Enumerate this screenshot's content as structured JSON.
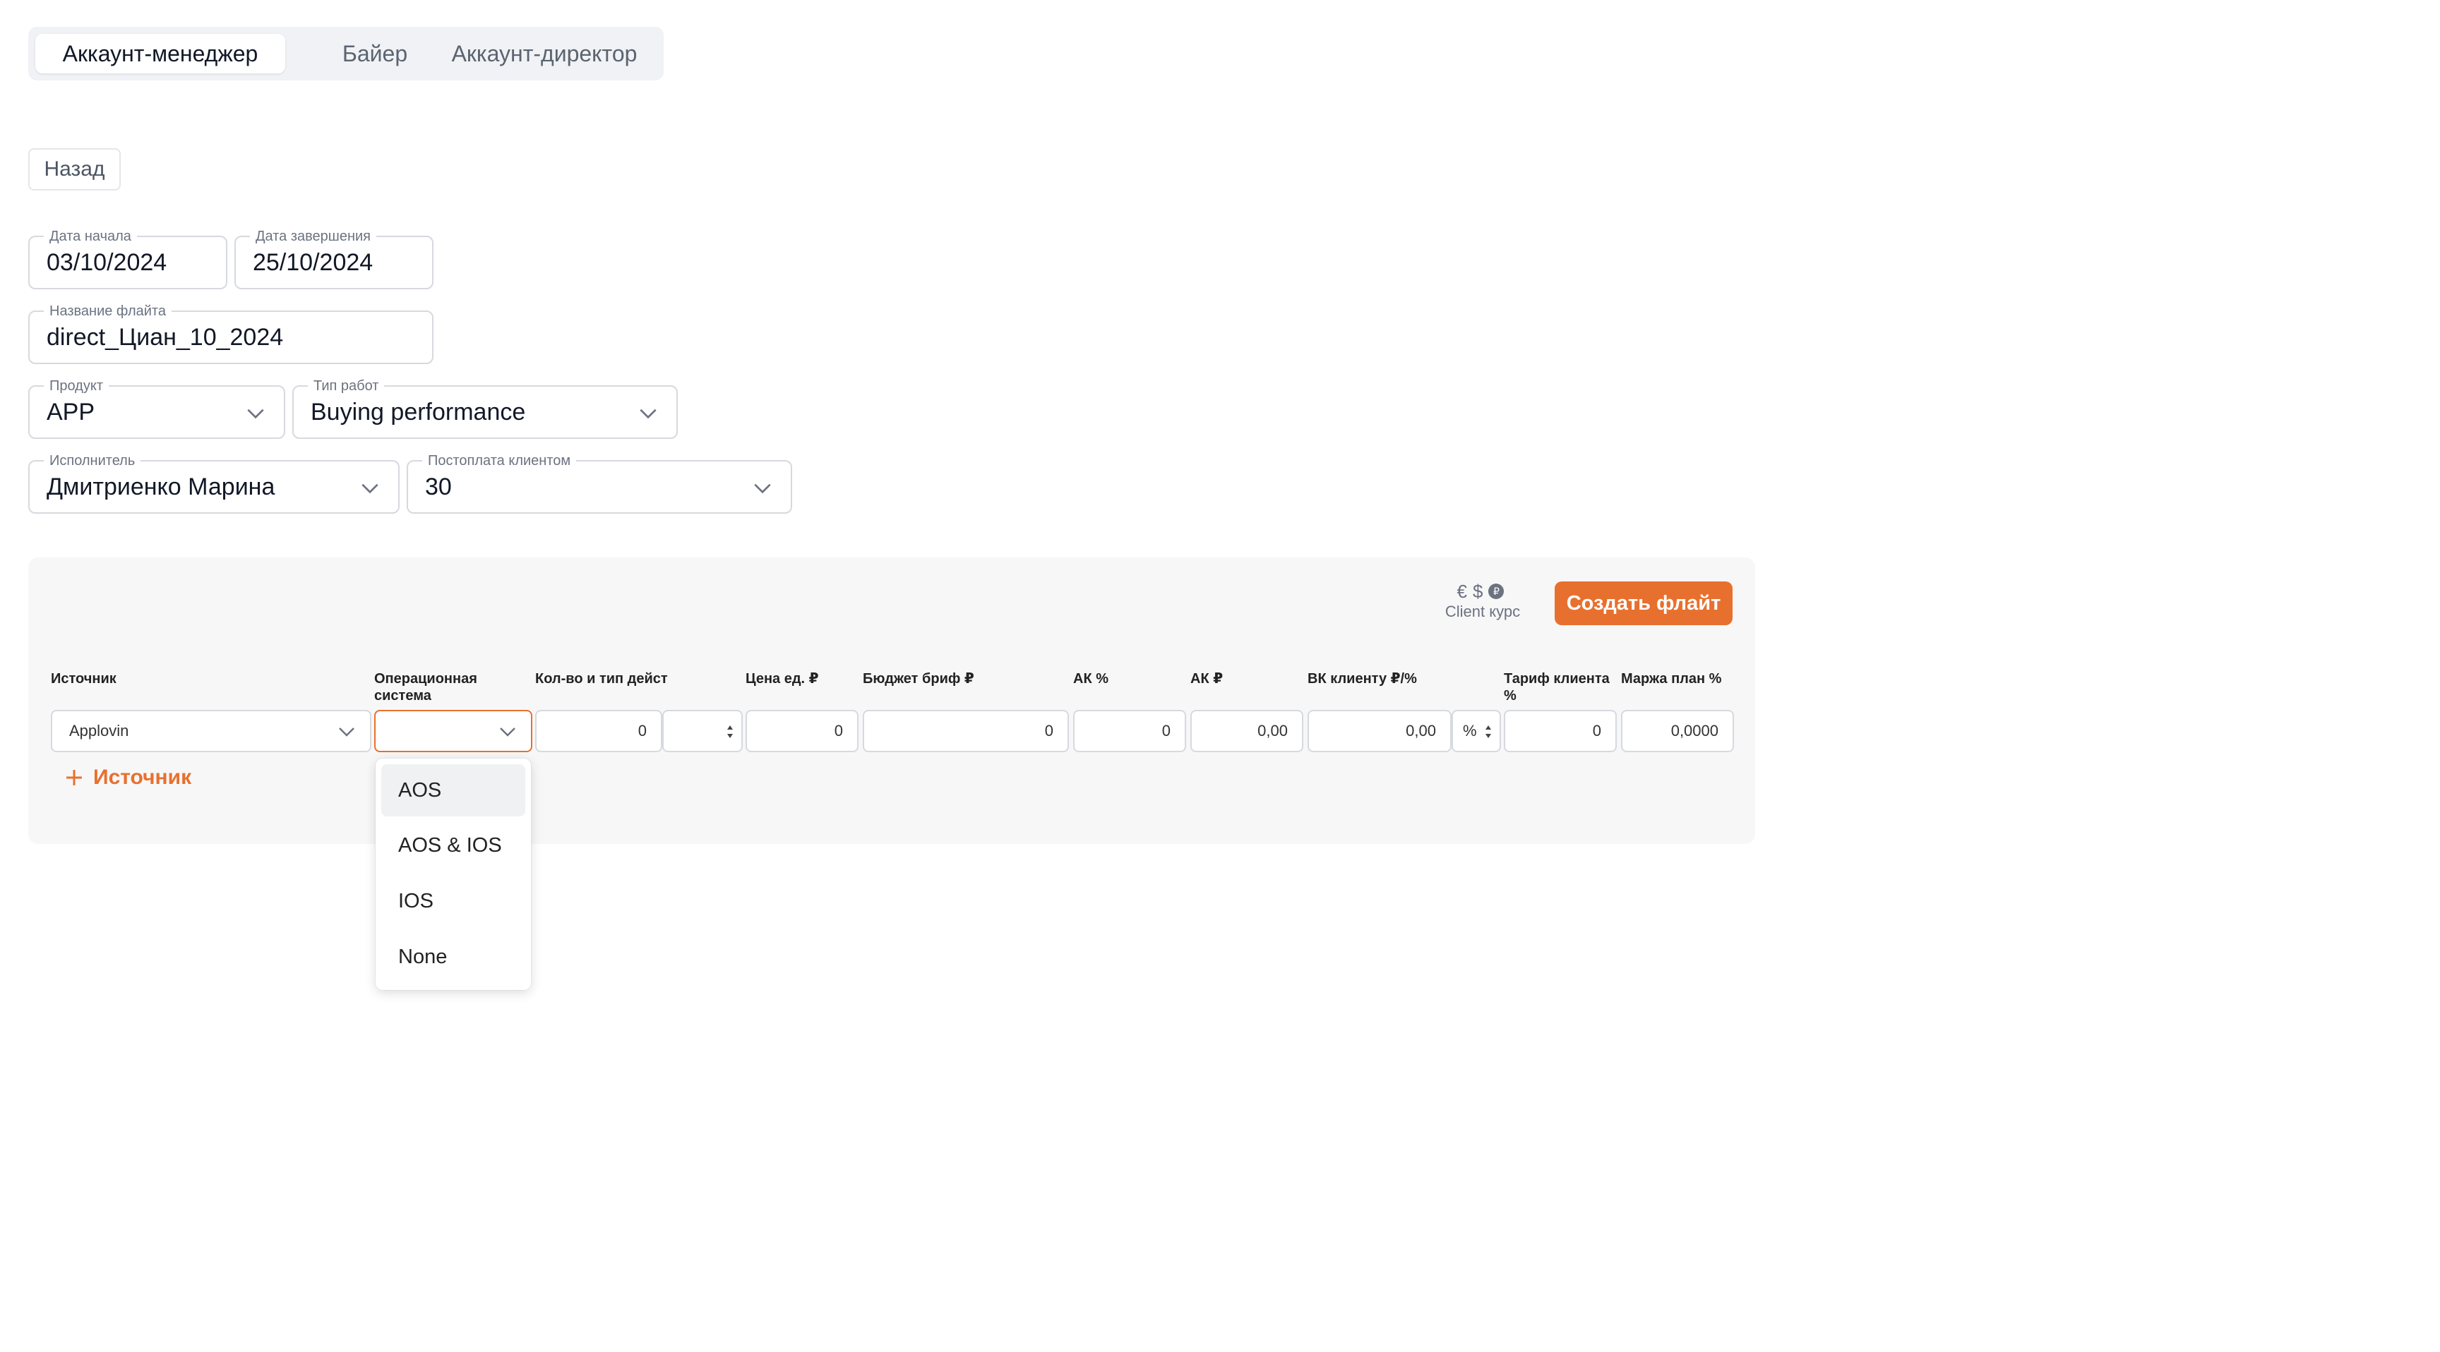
{
  "tabs": [
    "Аккаунт-менеджер",
    "Байер",
    "Аккаунт-директор"
  ],
  "active_tab": "Аккаунт-менеджер",
  "back_label": "Назад",
  "fields": {
    "start_date": {
      "label": "Дата начала",
      "value": "03/10/2024"
    },
    "end_date": {
      "label": "Дата завершения",
      "value": "25/10/2024"
    },
    "flight_name": {
      "label": "Название флайта",
      "value": "direct_Циан_10_2024"
    },
    "product": {
      "label": "Продукт",
      "value": "APP"
    },
    "work_type": {
      "label": "Тип работ",
      "value": "Buying performance"
    },
    "executor": {
      "label": "Исполнитель",
      "value": "Дмитриенко Марина"
    },
    "postpayment": {
      "label": "Постоплата клиентом",
      "value": "30"
    }
  },
  "panel": {
    "currency_symbols": [
      "€",
      "$",
      "₽"
    ],
    "client_rate_label": "Client курс",
    "create_button": "Создать флайт",
    "columns": {
      "source": "Источник",
      "os": "Операционная система",
      "qty": "Кол-во и тип дейст",
      "price": "Цена ед. ₽",
      "budget": "Бюджет бриф ₽",
      "ak_pct": "АК %",
      "ak_rub": "АК ₽",
      "vk": "ВК клиенту ₽/%",
      "tariff": "Тариф клиента %",
      "margin": "Маржа план %"
    },
    "row": {
      "source": "Applovin",
      "os": "",
      "qty": "0",
      "qty_type": "",
      "price": "0",
      "budget": "0",
      "ak_pct": "0",
      "ak_rub": "0,00",
      "vk": "0,00",
      "vk_unit": "%",
      "tariff": "0",
      "margin": "0,0000"
    },
    "add_source": "Источник"
  },
  "os_dropdown": {
    "options": [
      "AOS",
      "AOS & IOS",
      "IOS",
      "None"
    ],
    "highlighted": "AOS"
  },
  "colors": {
    "accent": "#e8702e"
  }
}
